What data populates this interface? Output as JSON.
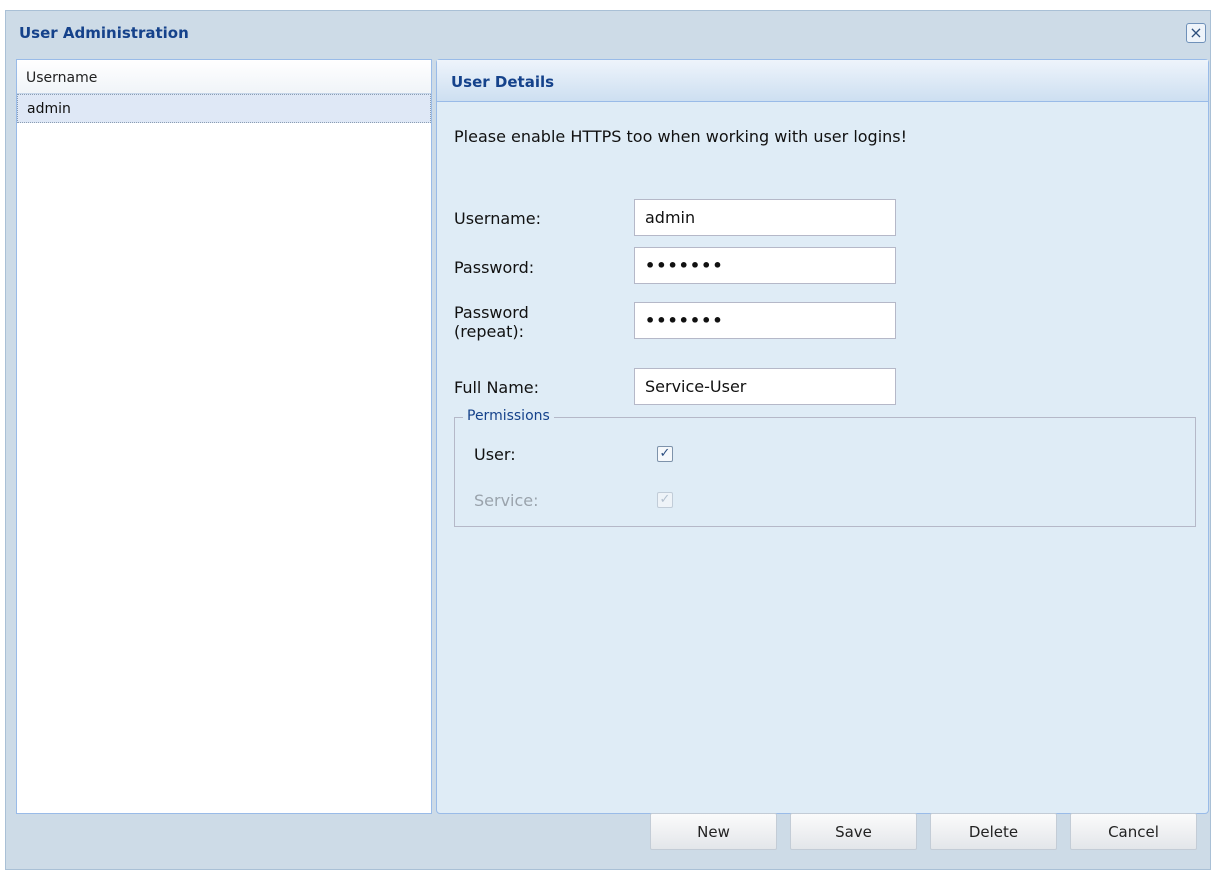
{
  "window": {
    "title": "User Administration",
    "close_icon": "×"
  },
  "user_list": {
    "column_header": "Username",
    "rows": [
      {
        "username": "admin"
      }
    ]
  },
  "details": {
    "header": "User Details",
    "notice": "Please enable HTTPS too when working with user logins!",
    "fields": {
      "username": {
        "label": "Username:",
        "value": "admin"
      },
      "password": {
        "label": "Password:",
        "value": "•••••••"
      },
      "password_repeat": {
        "label_line1": "Password",
        "label_line2": "(repeat):",
        "value": "•••••••"
      },
      "full_name": {
        "label": "Full Name:",
        "value": "Service-User"
      }
    },
    "permissions": {
      "legend": "Permissions",
      "user": {
        "label": "User:",
        "checked": true,
        "mark": "✓"
      },
      "service": {
        "label": "Service:",
        "checked": true,
        "disabled": true,
        "mark": "✓"
      }
    }
  },
  "buttons": {
    "new": "New",
    "save": "Save",
    "delete": "Delete",
    "cancel": "Cancel"
  }
}
